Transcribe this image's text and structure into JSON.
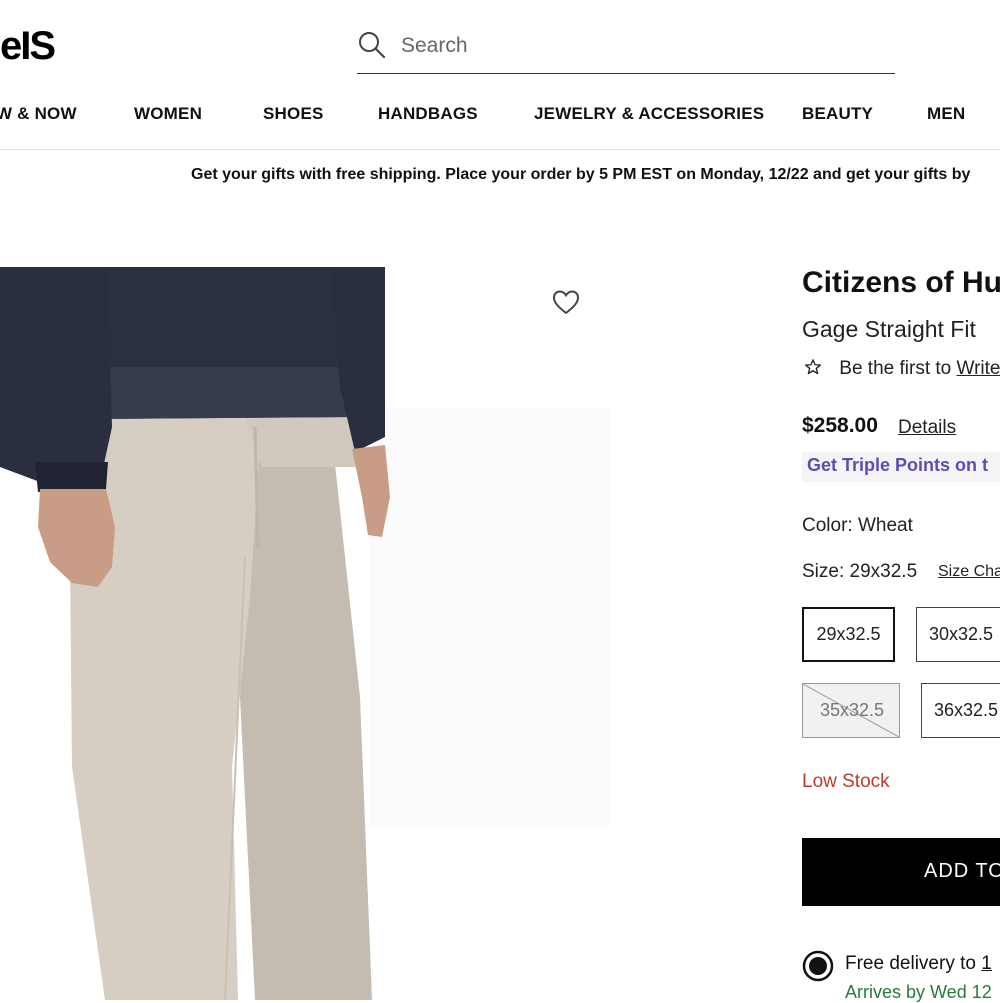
{
  "header": {
    "logo_text": "eIS",
    "search": {
      "placeholder": "Search",
      "value": ""
    }
  },
  "nav": {
    "items": [
      {
        "label": "W & NOW"
      },
      {
        "label": "WOMEN"
      },
      {
        "label": "SHOES"
      },
      {
        "label": "HANDBAGS"
      },
      {
        "label": "JEWELRY & ACCESSORIES"
      },
      {
        "label": "BEAUTY"
      },
      {
        "label": "MEN"
      }
    ]
  },
  "promo": {
    "text": "Get your gifts with free shipping. Place your order by 5 PM EST on Monday, 12/22 and get your gifts by"
  },
  "product": {
    "brand": "Citizens of Hu",
    "name": "Gage Straight Fit",
    "rating_prefix": "Be the first to",
    "rating_link": "Write",
    "price": "$258.00",
    "details_link": "Details",
    "points_text": "Get Triple Points on t",
    "color_label": "Color:",
    "color_value": "Wheat",
    "size_label": "Size:",
    "size_value": "29x32.5",
    "size_chart_link": "Size Cha",
    "sizes": [
      {
        "label": "29x32.5",
        "state": "selected"
      },
      {
        "label": "30x32.5",
        "state": "available"
      },
      {
        "label": "35x32.5",
        "state": "unavailable"
      },
      {
        "label": "36x32.5",
        "state": "available"
      }
    ],
    "stock_status": "Low Stock",
    "add_button": "ADD TO",
    "delivery_text": "Free delivery to",
    "delivery_link": "1",
    "arrives_text": "Arrives by Wed 12"
  },
  "icons": {
    "search": "search-icon",
    "heart": "heart-icon",
    "star": "star-outline-icon",
    "radio": "radio-selected-icon"
  },
  "colors": {
    "accent_points": "#5a4fb0",
    "low_stock": "#c0392b",
    "arrives": "#2a7a3a",
    "button": "#000000"
  }
}
